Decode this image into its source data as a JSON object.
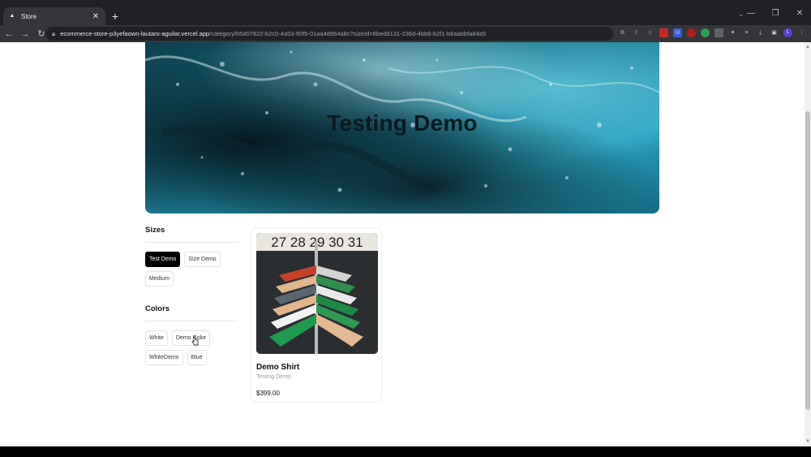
{
  "browser": {
    "tab_title": "Store",
    "tab_close": "✕",
    "new_tab": "+",
    "url_host": "ecommerce-store-p3yefaown-lautaro-aguilar.vercel.app",
    "url_path": "/category/05d07822-b2c0-4a53-90f5-01aa4d964a8c?sizeId=6bedd131-236d-4bb6-b2f1-b6aabbfa84a5",
    "window_controls": [
      "⌄",
      "—",
      "❐",
      "✕"
    ],
    "nav": {
      "back": "←",
      "forward": "→",
      "reload": "↻"
    },
    "profile_initial": "L"
  },
  "billboard": {
    "label": "Testing Demo"
  },
  "filters": {
    "sizes": {
      "heading": "Sizes",
      "options": [
        "Test Demo",
        "Size Demo",
        "Medium"
      ],
      "selected": "Test Demo"
    },
    "colors": {
      "heading": "Colors",
      "options": [
        "White",
        "Demo Color",
        "WhiteDemo",
        "Blue"
      ]
    }
  },
  "product": {
    "name": "Demo Shirt",
    "category": "Testing Demo",
    "price": "$399.00",
    "image_sign": "27 28 29 30 31"
  },
  "colors": {
    "chrome_dark": "#202124",
    "chrome_toolbar": "#35363a",
    "chip_active_bg": "#000000",
    "billboard_teal": "#1c8aa6"
  }
}
